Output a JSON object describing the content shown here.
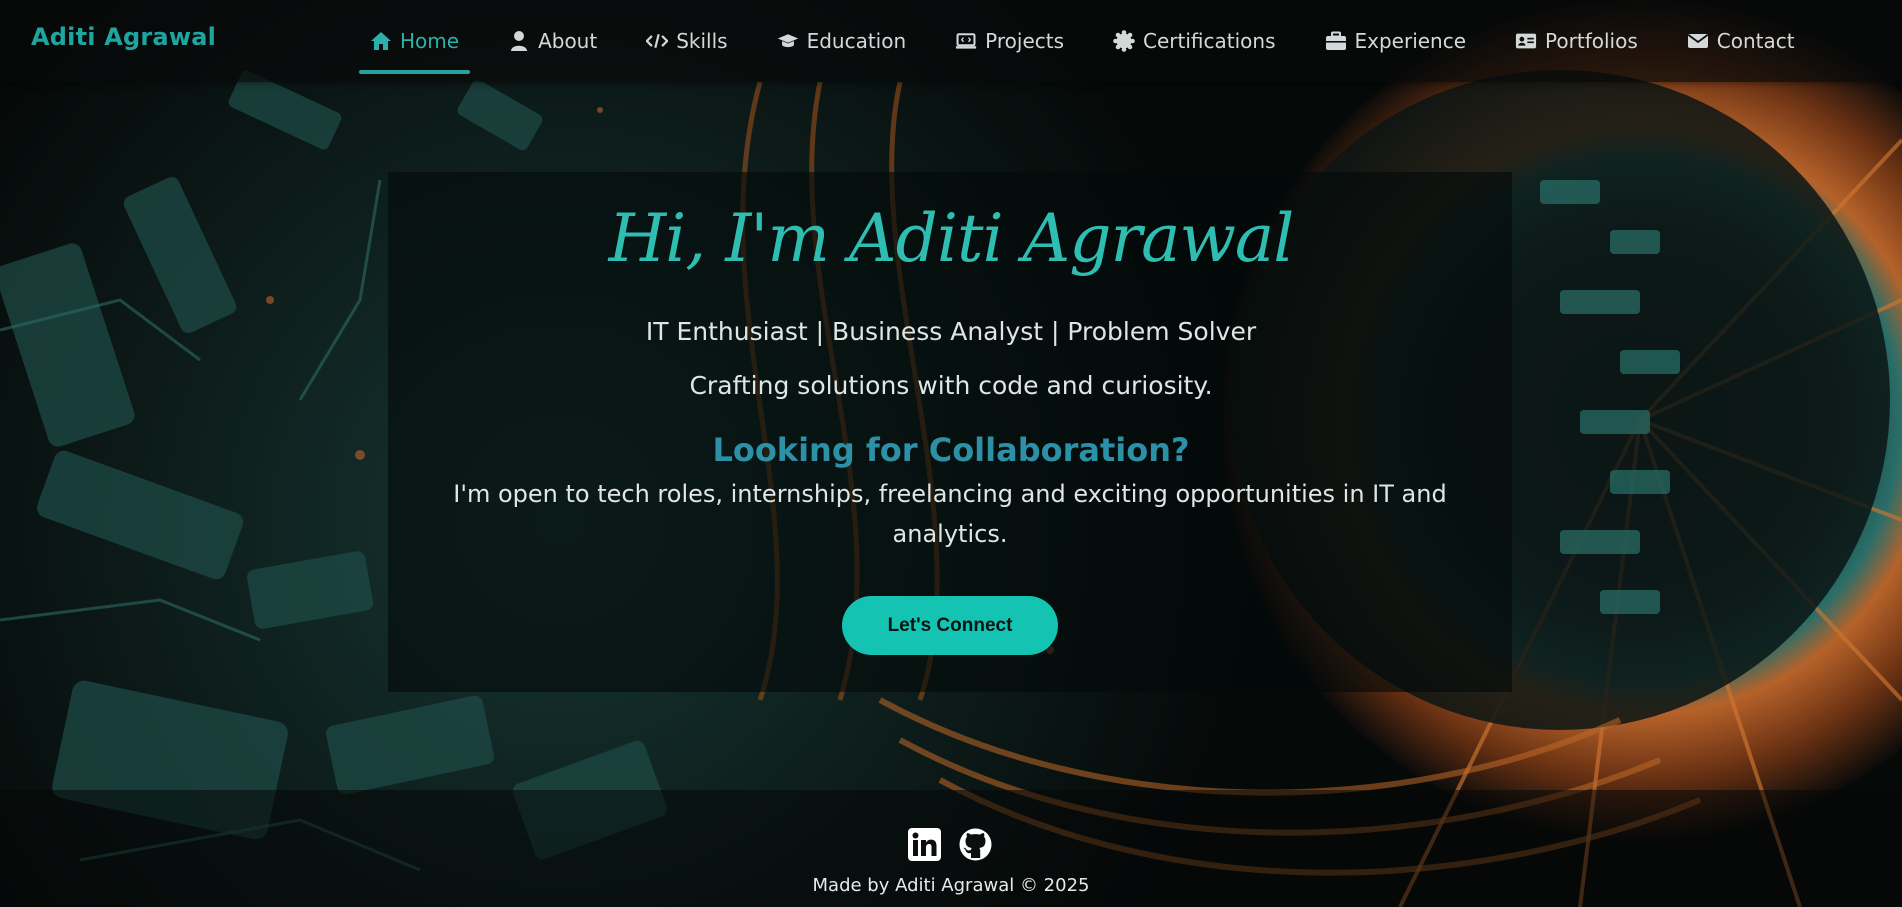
{
  "brand": "Aditi Agrawal",
  "nav": [
    {
      "label": "Home",
      "icon": "home-icon",
      "active": true
    },
    {
      "label": "About",
      "icon": "user-icon"
    },
    {
      "label": "Skills",
      "icon": "code-icon"
    },
    {
      "label": "Education",
      "icon": "graduation-cap-icon"
    },
    {
      "label": "Projects",
      "icon": "laptop-code-icon"
    },
    {
      "label": "Certifications",
      "icon": "certificate-icon"
    },
    {
      "label": "Experience",
      "icon": "briefcase-icon"
    },
    {
      "label": "Portfolios",
      "icon": "id-card-icon"
    },
    {
      "label": "Contact",
      "icon": "envelope-icon"
    }
  ],
  "hero": {
    "title": "Hi, I'm Aditi Agrawal",
    "subtitle": "IT Enthusiast | Business Analyst | Problem Solver",
    "tagline": "Crafting solutions with code and curiosity.",
    "collab_heading": "Looking for Collaboration?",
    "collab_text": "I'm open to tech roles, internships, freelancing and exciting opportunities in IT and analytics.",
    "cta_label": "Let's Connect"
  },
  "footer": {
    "social": [
      "linkedin-icon",
      "github-icon"
    ],
    "text": "Made by Aditi Agrawal © 2025"
  },
  "colors": {
    "accent": "#14c3b2",
    "brand": "#1fa5a0",
    "heading": "#2c90a6",
    "title": "#2fbdb2",
    "nav_active": "#2bb0aa"
  }
}
